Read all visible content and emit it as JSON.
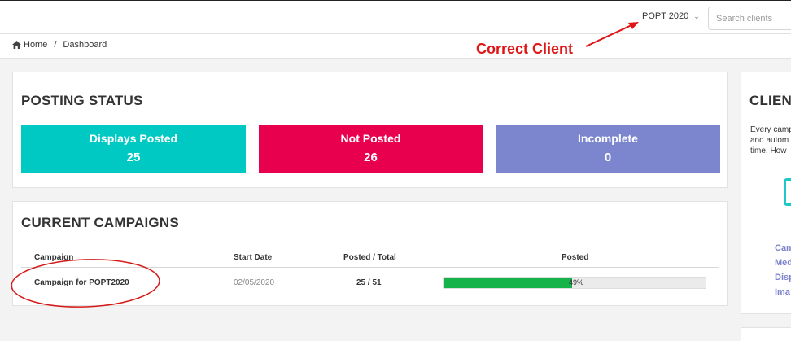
{
  "topbar": {
    "client_name": "POPT 2020",
    "search_placeholder": "Search clients"
  },
  "breadcrumb": {
    "home": "Home",
    "separator": "/",
    "current": "Dashboard"
  },
  "annotation": {
    "label": "Correct Client",
    "color": "#e01515"
  },
  "posting_status": {
    "title": "POSTING STATUS",
    "stats": [
      {
        "label": "Displays Posted",
        "value": "25",
        "color": "#00c9c4"
      },
      {
        "label": "Not Posted",
        "value": "26",
        "color": "#e8004f"
      },
      {
        "label": "Incomplete",
        "value": "0",
        "color": "#7c86cf"
      }
    ]
  },
  "campaigns": {
    "title": "CURRENT CAMPAIGNS",
    "headers": {
      "campaign": "Campaign",
      "start_date": "Start Date",
      "posted_total": "Posted / Total",
      "posted": "Posted"
    },
    "rows": [
      {
        "campaign": "Campaign for POPT2020",
        "start_date": "02/05/2020",
        "posted_total": "25 / 51",
        "progress": 49,
        "progress_label": "49%"
      }
    ]
  },
  "side": {
    "title": "CLIENT",
    "text": [
      "Every camp",
      "and autom",
      "time. How"
    ],
    "links": [
      "Cam",
      "Med",
      "Disp",
      "Ima"
    ]
  },
  "colors": {
    "accent_teal": "#00c9c4",
    "accent_red": "#e8004f",
    "accent_purple": "#7c86cf",
    "progress_green": "#15b34a",
    "link_color": "#7b83cc"
  }
}
